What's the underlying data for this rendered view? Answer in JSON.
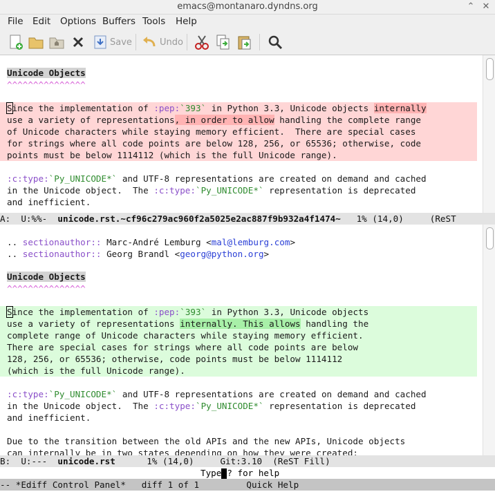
{
  "window": {
    "title": "emacs@montanaro.dyndns.org",
    "minimize": "⌃",
    "close": "✕"
  },
  "menu": [
    "File",
    "Edit",
    "Options",
    "Buffers",
    "Tools",
    "Help"
  ],
  "toolbar": {
    "save_label": "Save",
    "undo_label": "Undo"
  },
  "colors": {
    "diff_a_bg": "#ffd6d6",
    "diff_a_fine": "#ffb3b3",
    "diff_b_bg": "#dcfcdc",
    "diff_b_fine": "#a8f0a8",
    "modeline_active": "#c4c4c4",
    "role": "#8a4fc9",
    "literal": "#2e8b2e",
    "link": "#2a3fd6"
  },
  "bufA": {
    "heading": "Unicode Objects",
    "heading_underline": "^^^^^^^^^^^^^^^",
    "para1": [
      {
        "a": "S",
        "b": "ince the implementation of ",
        "c": ":pep:",
        "d": "`393`",
        "e": " in Python 3.3, Unicode objects ",
        "f": "internally"
      },
      {
        "a": "use a variety of representations",
        "b": ", in order to allow",
        "c": " handling the complete range"
      },
      "of Unicode characters while staying memory efficient.  There are special cases",
      "for strings where all code points are below 128, 256, or 65536; otherwise, code",
      "points must be below 1114112 (which is the full Unicode range)."
    ],
    "para2": [
      {
        "a": ":c:type:",
        "b": "`Py_UNICODE*`",
        "c": " and UTF-8 representations are created on demand and cached"
      },
      {
        "a": "in the Unicode object.  The ",
        "b": ":c:type:",
        "c": "`Py_UNICODE*`",
        "d": " representation is deprecated"
      },
      "and inefficient."
    ],
    "modeline": {
      "prefix": "A:  U:%%-  ",
      "buffer": "unicode.rst.~cf96c279ac960f2a5025e2ac887f9b932a4f1474~",
      "pos": "   1% (14,0)     (ReST"
    }
  },
  "bufB": {
    "authors": [
      {
        "a": ".. ",
        "b": "sectionauthor::",
        "c": " Marc-André Lemburg <",
        "d": "mal@lemburg.com",
        "e": ">"
      },
      {
        "a": ".. ",
        "b": "sectionauthor::",
        "c": " Georg Brandl <",
        "d": "georg@python.org",
        "e": ">"
      }
    ],
    "heading": "Unicode Objects",
    "heading_underline": "^^^^^^^^^^^^^^^",
    "para1": [
      {
        "a": "S",
        "b": "ince the implementation of ",
        "c": ":pep:",
        "d": "`393`",
        "e": " in Python 3.3, Unicode objects"
      },
      {
        "a": "use a variety of representations ",
        "b": "internally. This allows",
        "c": " handling the"
      },
      "complete range of Unicode characters while staying memory efficient.",
      "There are special cases for strings where all code points are below",
      "128, 256, or 65536; otherwise, code points must be below 1114112",
      "(which is the full Unicode range)."
    ],
    "para2": [
      {
        "a": ":c:type:",
        "b": "`Py_UNICODE*`",
        "c": " and UTF-8 representations are created on demand and cached"
      },
      {
        "a": "in the Unicode object.  The ",
        "b": ":c:type:",
        "c": "`Py_UNICODE*`",
        "d": " representation is deprecated"
      },
      "and inefficient."
    ],
    "para3": [
      "Due to the transition between the old APIs and the new APIs, Unicode objects",
      "can internally be in two states depending on how they were created:"
    ],
    "modeline": {
      "prefix": "B:  U:---  ",
      "buffer": "unicode.rst",
      "pos": "      1% (14,0)     Git:3.10  (ReST Fill)"
    }
  },
  "minibuffer": {
    "before": "Type",
    "after": "? for help"
  },
  "ediff_modeline": "-- *Ediff Control Panel*   diff 1 of 1         Quick Help"
}
